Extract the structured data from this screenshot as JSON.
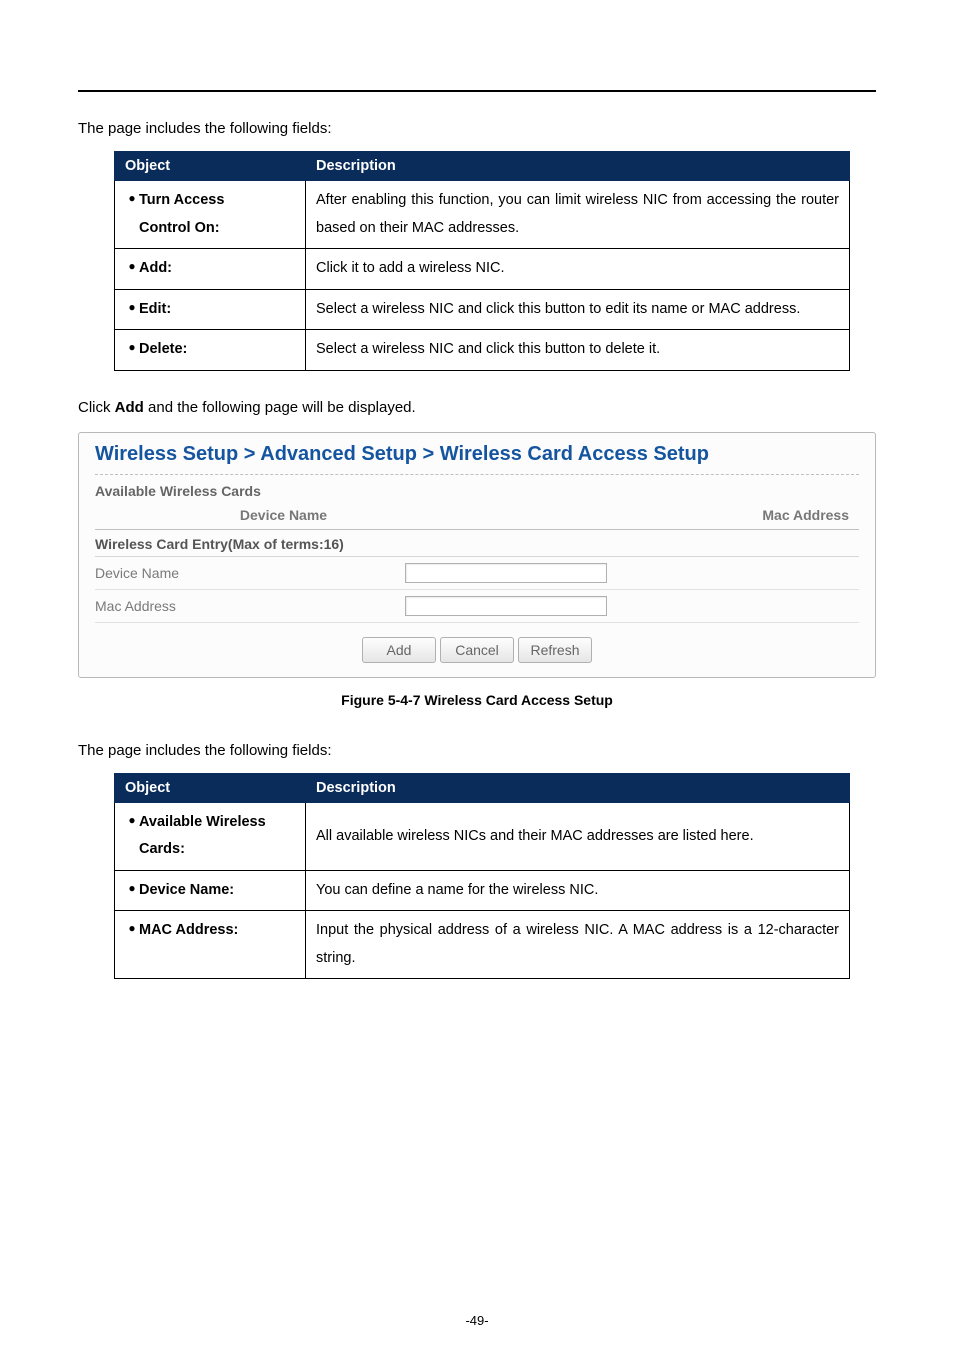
{
  "intro1": "The page includes the following fields:",
  "table1": {
    "header_object": "Object",
    "header_desc": "Description",
    "rows": [
      {
        "obj1": "Turn Access",
        "obj2": "Control On:",
        "desc": "After enabling this function, you can limit wireless NIC from accessing the router based on their MAC addresses."
      },
      {
        "obj1": "Add:",
        "desc": "Click it to add a wireless NIC."
      },
      {
        "obj1": "Edit:",
        "desc": "Select a wireless NIC and click this button to edit its name or MAC address."
      },
      {
        "obj1": "Delete:",
        "desc": "Select a wireless NIC and click this button to delete it."
      }
    ]
  },
  "click_add": {
    "pre": "Click ",
    "bold": "Add",
    "post": " and the following page will be displayed."
  },
  "setup": {
    "crumb": "Wireless Setup > Advanced Setup > Wireless Card Access Setup",
    "avail_title": "Available Wireless Cards",
    "col_device": "Device Name",
    "col_mac": "Mac Address",
    "entry_title": "Wireless Card Entry(Max of terms:16)",
    "label_device": "Device Name",
    "label_mac": "Mac Address",
    "btn_add": "Add",
    "btn_cancel": "Cancel",
    "btn_refresh": "Refresh"
  },
  "figure_caption": "Figure 5-4-7 Wireless Card Access Setup",
  "intro2": "The page includes the following fields:",
  "table2": {
    "header_object": "Object",
    "header_desc": "Description",
    "rows": [
      {
        "obj1": "Available Wireless",
        "obj2": "Cards:",
        "desc": "All available wireless NICs and their MAC addresses are listed here."
      },
      {
        "obj1": "Device Name:",
        "desc": "You can define a name for the wireless NIC."
      },
      {
        "obj1": "MAC Address:",
        "desc": "Input the physical address of a wireless NIC. A MAC address is a 12-character string."
      }
    ]
  },
  "page_number": "-49-"
}
